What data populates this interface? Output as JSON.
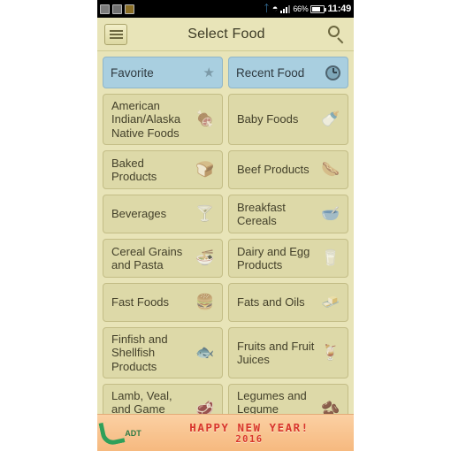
{
  "statusbar": {
    "left_icons": [
      "gallery-icon",
      "note-icon",
      "memory-card-icon"
    ],
    "right_icons": [
      "bluetooth-icon",
      "wifi-icon",
      "signal-icon"
    ],
    "battery_percent": "66%",
    "clock": "11:49"
  },
  "header": {
    "menu_label": "menu-icon",
    "title": "Select Food",
    "search_label": "search-icon"
  },
  "tabs": [
    {
      "label": "Favorite",
      "icon": "star-icon",
      "selected": true
    },
    {
      "label": "Recent Food",
      "icon": "clock-icon",
      "selected": true
    }
  ],
  "categories": [
    {
      "name": "American Indian/Alaska Native Foods",
      "icon": "native-foods-icon",
      "glyph": "🍖",
      "size": "h3"
    },
    {
      "name": "Baby Foods",
      "icon": "baby-bottle-icon",
      "glyph": "🍼",
      "size": "h3"
    },
    {
      "name": "Baked Products",
      "icon": "oven-icon",
      "glyph": "🍞",
      "size": "h2"
    },
    {
      "name": "Beef Products",
      "icon": "sausage-icon",
      "glyph": "🌭",
      "size": "h2"
    },
    {
      "name": "Beverages",
      "icon": "cocktail-icon",
      "glyph": "🍸",
      "size": "h2"
    },
    {
      "name": "Breakfast Cereals",
      "icon": "cereal-bowl-icon",
      "glyph": "🥣",
      "size": "h2"
    },
    {
      "name": "Cereal Grains and Pasta",
      "icon": "pasta-icon",
      "glyph": "🍜",
      "size": "h2"
    },
    {
      "name": "Dairy and Egg Products",
      "icon": "milk-eggs-icon",
      "glyph": "🥛",
      "size": "h2"
    },
    {
      "name": "Fast Foods",
      "icon": "burger-drink-icon",
      "glyph": "🍔",
      "size": "h2"
    },
    {
      "name": "Fats and Oils",
      "icon": "butter-icon",
      "glyph": "🧈",
      "size": "h2"
    },
    {
      "name": "Finfish and Shellfish Products",
      "icon": "fish-icon",
      "glyph": "🐟",
      "size": "h3"
    },
    {
      "name": "Fruits and Fruit Juices",
      "icon": "fruit-juice-icon",
      "glyph": "🍹",
      "size": "h3"
    },
    {
      "name": "Lamb, Veal, and Game Products",
      "icon": "meat-cut-icon",
      "glyph": "🥩",
      "size": "h3"
    },
    {
      "name": "Legumes and Legume Products",
      "icon": "beans-icon",
      "glyph": "🫘",
      "size": "h3"
    }
  ],
  "banner": {
    "logo_text": "ADT",
    "line1": "HAPPY NEW YEAR!",
    "line2": "2016"
  },
  "colors": {
    "app_background": "#e8e4b8",
    "cell_background": "#ddd9a8",
    "tab_selected": "#a9cfe0",
    "banner_text": "#d8352b",
    "status_bar": "#000000"
  }
}
